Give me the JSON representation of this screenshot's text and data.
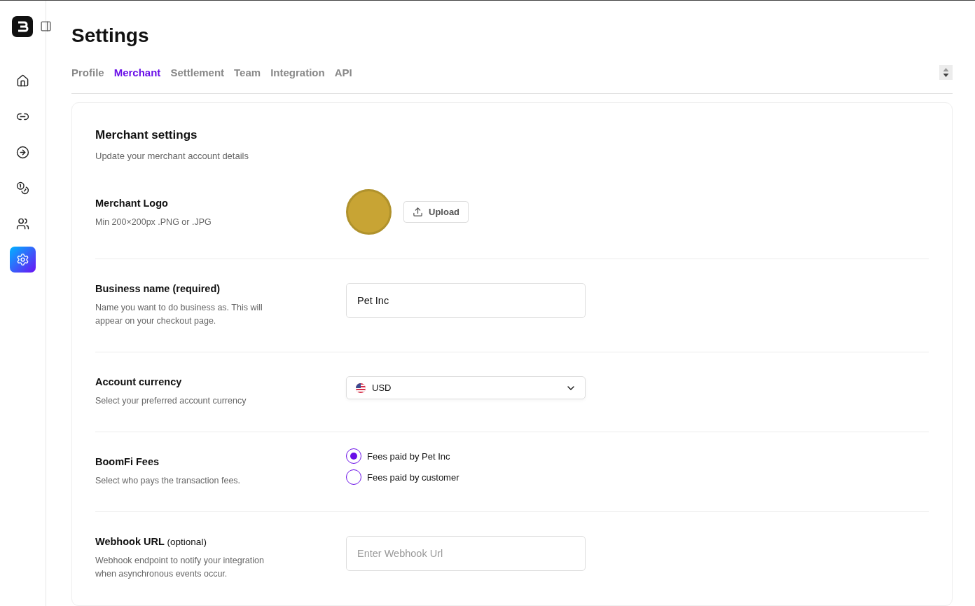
{
  "sidebar": {
    "items": [
      {
        "kind": "home",
        "selected": false
      },
      {
        "kind": "link",
        "selected": false
      },
      {
        "kind": "login",
        "selected": false
      },
      {
        "kind": "coins",
        "selected": false
      },
      {
        "kind": "users",
        "selected": false
      },
      {
        "kind": "settings",
        "selected": true
      }
    ]
  },
  "page": {
    "title": "Settings"
  },
  "tabs": [
    {
      "label": "Profile",
      "selected": false
    },
    {
      "label": "Merchant",
      "selected": true
    },
    {
      "label": "Settlement",
      "selected": false
    },
    {
      "label": "Team",
      "selected": false
    },
    {
      "label": "Integration",
      "selected": false
    },
    {
      "label": "API",
      "selected": false
    }
  ],
  "card": {
    "title": "Merchant settings",
    "subtitle": "Update your merchant account details",
    "rows": [
      {
        "kind": "logo",
        "title": "Merchant Logo",
        "description": "Min 200×200px .PNG or .JPG",
        "button": "Upload"
      },
      {
        "kind": "text",
        "title": "Business name (required)",
        "description": "Name you want to do business as. This will appear on your checkout page.",
        "value": "Pet Inc"
      },
      {
        "kind": "select",
        "title": "Account currency",
        "description": "Select your preferred account currency",
        "value": "USD"
      },
      {
        "kind": "radio",
        "title": "BoomFi Fees",
        "description": "Select who pays the transaction fees.",
        "options": [
          {
            "label": "Fees paid by Pet Inc",
            "selected": true
          },
          {
            "label": "Fees paid by customer",
            "selected": false
          }
        ]
      },
      {
        "kind": "text",
        "title": "Webhook URL",
        "note": "(optional)",
        "description": "Webhook endpoint to notify your integration when asynchronous events occur.",
        "placeholder": "Enter Webhook Url"
      }
    ]
  }
}
